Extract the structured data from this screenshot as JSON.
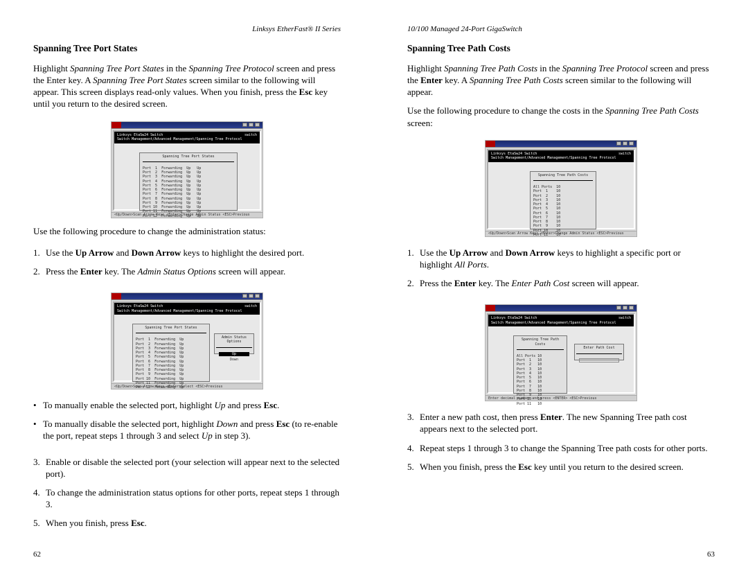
{
  "leftHeader": "Linksys EtherFast® II Series",
  "rightHeader": "10/100 Managed 24-Port GigaSwitch",
  "left": {
    "title": "Spanning Tree Port States",
    "intro_1a": "Highlight ",
    "intro_1b": "Spanning Tree Port States",
    "intro_1c": " in the ",
    "intro_1d": "Spanning Tree Protocol",
    "intro_1e": " screen and press the Enter key. A ",
    "intro_1f": "Spanning Tree Port States",
    "intro_1g": " screen similar to the following will appear. This screen displays read-only values. When you finish, press the ",
    "intro_esc": "Esc",
    "intro_1h": " key until you return to the desired screen.",
    "proc_heading": "Use the following procedure to change the administration status:",
    "s1a": "Use the ",
    "s1b": "Up Arrow",
    "s1c": " and ",
    "s1d": "Down Arrow",
    "s1e": " keys to highlight the desired port.",
    "s2a": "Press the ",
    "s2b": "Enter",
    "s2c": " key. The ",
    "s2d": "Admin Status Options",
    "s2e": " screen will appear.",
    "b1a": "To manually enable the selected port, highlight ",
    "b1b": "Up",
    "b1c": " and press ",
    "b1d": "Esc",
    "b1e": ".",
    "b2a": "To manually disable the selected port, highlight ",
    "b2b": "Down",
    "b2c": " and press ",
    "b2d": "Esc",
    "b2e": " (to re-enable the port, repeat steps 1 through 3 and select ",
    "b2f": "Up",
    "b2g": " in step 3).",
    "s3": "Enable or disable the selected port (your selection will appear next to the selected port).",
    "s4": "To change the administration status options for other ports, repeat steps 1 through 3.",
    "s5a": "When you finish, press ",
    "s5b": "Esc",
    "s5c": ".",
    "folio": "62",
    "fig_head_l": "Linksys EtaSw24 Switch",
    "fig_head_r": "switch",
    "fig_breadcrumb": "Switch Management/Advanced Management/Spanning Tree Protocol",
    "fig1_panel_title": "Spanning Tree Port States",
    "fig1_status": "<Up/Down>Scan Arrow Keys  <Enter>Change Admin Status            <ESC>Previous",
    "fig2_panel_title": "Spanning Tree Port States",
    "fig2_popup": "Admin Status Options",
    "fig2_status": "<Up/Down>Scan Arrow Keys  <Enter>Select                          <ESC>Previous"
  },
  "right": {
    "title": "Spanning Tree Path Costs",
    "intro_1a": "Highlight ",
    "intro_1b": "Spanning Tree Path Costs",
    "intro_1c": " in the ",
    "intro_1d": "Spanning Tree Protocol",
    "intro_1e": " screen and press the ",
    "intro_enter": "Enter",
    "intro_1f": " key. A ",
    "intro_1g": "Spanning Tree Path Costs",
    "intro_1h": " screen similar to the following will appear.",
    "proc_a": "Use the following procedure to change the costs in the ",
    "proc_b": "Spanning Tree Path Costs",
    "proc_c": " screen:",
    "s1a": "Use the ",
    "s1b": "Up Arrow",
    "s1c": " and ",
    "s1d": "Down Arrow",
    "s1e": " keys to highlight a specific port or highlight ",
    "s1f": "All Ports",
    "s1g": ".",
    "s2a": "Press the ",
    "s2b": "Enter",
    "s2c": " key. The ",
    "s2d": "Enter Path Cost",
    "s2e": " screen will appear.",
    "s3a": "Enter a new path cost, then press ",
    "s3b": "Enter",
    "s3c": ". The new Spanning Tree path cost appears next to the selected port.",
    "s4": "Repeat steps 1 through 3 to change the Spanning Tree path costs for other ports.",
    "s5a": "When you finish, press the ",
    "s5b": "Esc",
    "s5c": " key until you return to the desired screen.",
    "folio": "63",
    "fig_head_l": "Linksys EtaSw24 Switch",
    "fig_head_r": "switch",
    "fig_breadcrumb": "Switch Management/Advanced Management/Spanning Tree Protocol",
    "fig1_panel_title": "Spanning Tree Path Costs",
    "fig1_status": "<Up/Down>Scan Arrow Keys  <Enter>Change Admin Status            <ESC>Previous",
    "fig2_panel_title": "Spanning Tree Path Costs",
    "fig2_popup": "Enter Path Cost",
    "fig2_status": "Enter decimal number and press <ENTER>                           <ESC>Previous"
  }
}
